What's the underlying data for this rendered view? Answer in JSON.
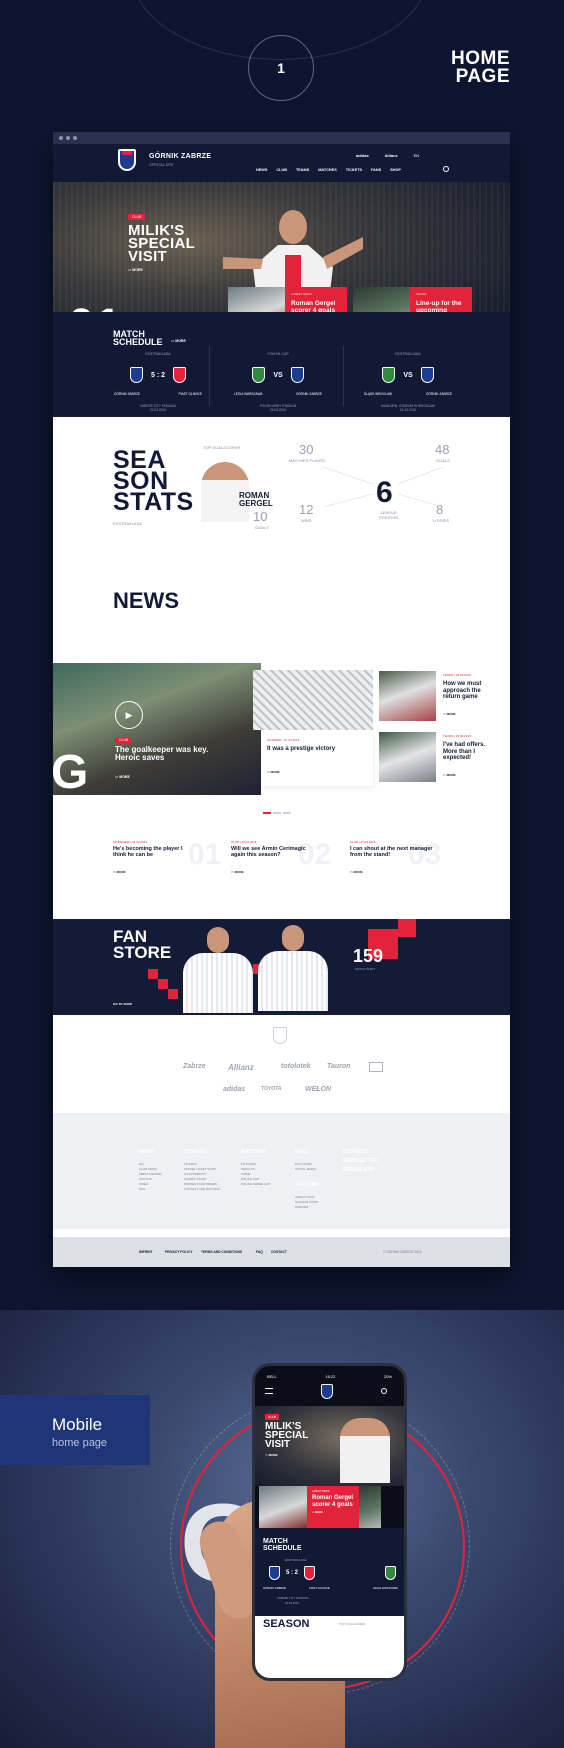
{
  "header": {
    "page_number": "1",
    "title_line1": "HOME",
    "title_line2": "PAGE"
  },
  "site": {
    "brand": "GÓRNIK ZABRZE",
    "brand_sub": "OFFICIAL SITE",
    "nav": [
      "NEWS",
      "CLUB",
      "TEAMS",
      "MATCHES",
      "TICKETS",
      "FANS",
      "SHOP"
    ],
    "nav_right": {
      "sponsor1": "adidas",
      "sponsor2": "Allianz",
      "lang": "EN"
    }
  },
  "hero": {
    "tag": "CLUB",
    "title_l1": "MILIK'S",
    "title_l2": "SPECIAL",
    "title_l3": "VISIT",
    "more": "MORE",
    "big_number": "01",
    "card1": {
      "kicker": "LATEST NEWS",
      "title": "Roman Gergel scorer 4 goals",
      "more": "MORE"
    },
    "card2": {
      "kicker": "TEAMS",
      "title": "Line-up for the upcoming match",
      "more": "MORE"
    }
  },
  "schedule": {
    "title_l1": "MATCH",
    "title_l2": "SCHEDULE",
    "more": "MORE",
    "matches": [
      {
        "competition": "EKSTRAKLASA",
        "home": "GÓRNIK ZABRZE",
        "away": "PIAST GLIWICE",
        "score": "5 : 2",
        "venue": "ZABRZE CITY STADIUM",
        "date": "20.03.2016"
      },
      {
        "competition": "POLISH CUP",
        "home": "LEGIA WARSZAWA",
        "away": "GÓRNIK ZABRZE",
        "score": "VS",
        "venue": "POLISH ARMY STADIUM",
        "date": "26.03.2016"
      },
      {
        "competition": "EKSTRAKLASA",
        "home": "ŚLĄSK WROCŁAW",
        "away": "GÓRNIK ZABRZE",
        "score": "VS",
        "venue": "MUNICIPAL STADIUM IN WROCŁAW",
        "date": "01.04.2016"
      }
    ]
  },
  "stats": {
    "title_l1": "SEA",
    "title_l2": "SON",
    "title_l3": "STATS",
    "league": "EKSTRAKLASA",
    "top_scorer_label": "TOP GOALSCORER",
    "scorer_first": "ROMAN",
    "scorer_last": "GERGEL",
    "scorer_goals": "10",
    "scorer_goals_label": "GOALS",
    "matches_played": "30",
    "matches_played_label": "MATCHES PLAYED",
    "goals": "48",
    "goals_label": "GOALS",
    "position": "6",
    "position_label_l1": "LEAGUE",
    "position_label_l2": "POSITION",
    "wins": "12",
    "wins_label": "WINS",
    "losses": "8",
    "losses_label": "LOSSES"
  },
  "news": {
    "title": "NEWS",
    "feature": {
      "tag": "CLUB",
      "title": "The goalkeeper was key. Heroic saves",
      "more": "MORE"
    },
    "card_prestige": {
      "kicker": "ACADEMY | 27.03.2016",
      "title": "It was a prestige victory",
      "more": "MORE"
    },
    "card_approach": {
      "kicker": "TEAMS | 26.03.2016",
      "title": "How we must approach the return game",
      "more": "MORE"
    },
    "card_offers": {
      "kicker": "TEAMS | 25.03.2016",
      "title": "I've had offers. More than I expected!",
      "more": "MORE"
    },
    "row": [
      {
        "kicker": "INTERVIEW | 24.03.2016",
        "title": "He's becoming the player I think he can be",
        "more": "MORE",
        "ghost": "01"
      },
      {
        "kicker": "CLUB | 22.03.2016",
        "title": "Will we see Armin Cerimagic again this season?",
        "more": "MORE",
        "ghost": "02"
      },
      {
        "kicker": "CLUB | 20.03.2016",
        "title": "I can shout at the next manager from the stand!",
        "more": "MORE",
        "ghost": "03"
      }
    ]
  },
  "fanstore": {
    "title_l1": "FAN",
    "title_l2": "STORE",
    "count": "159",
    "count_label": "MATCH SHIRT",
    "cta": "GO TO SHOP"
  },
  "sponsors": [
    "Zabrze",
    "Allianz",
    "totolotek",
    "Tauron",
    "adidas",
    "TOYOTA",
    "WEŁON"
  ],
  "footer": {
    "columns": [
      {
        "heading": "NEWS",
        "items": [
          "ALL",
          "CLUB NEWS",
          "MEDIA CENTER",
          "PHOTOS",
          "VIDEO",
          "RSS"
        ]
      },
      {
        "heading": "TICKETS",
        "items": [
          "TICKETS",
          "ONLINE TICKET SHOP",
          "ACCESSIBILITY",
          "COMBO TICKET",
          "PAYMENT AND PRICES",
          "CONTACT AND BOOKING"
        ]
      },
      {
        "heading": "MATCHES",
        "items": [
          "FIXTURES",
          "RESULTS",
          "TABLE",
          "POLISH CUP",
          "POLISH SUPER CUP"
        ]
      },
      {
        "heading": "FANS",
        "items": [
          "FAN CLUBS",
          "SOCIAL MEDIA"
        ]
      }
    ],
    "stadium": {
      "heading": "STADIUM",
      "items": [
        "ARENA TOUR",
        "STADIUM FOOD",
        "PARKING"
      ]
    },
    "extras": [
      "BUSINESS",
      "NEWSLETTER",
      "MOBILE APP"
    ],
    "legal": [
      "IMPRINT",
      "PRIVACY POLICY",
      "TERMS AND CONDITIONS",
      "FAQ",
      "CONTACT"
    ],
    "copyright": "© GÓRNIK ZABRZE 2016"
  },
  "mobile": {
    "label": "Mobile",
    "sublabel": "home page",
    "status_carrier": "BELL",
    "status_time": "16:22",
    "status_battery": "20%",
    "hero_tag": "CLUB",
    "hero_l1": "MILIK'S",
    "hero_l2": "SPECIAL",
    "hero_l3": "VISIT",
    "hero_more": "MORE",
    "card1": {
      "kicker": "LATEST NEWS",
      "title": "Roman Gergel scorer 4 goals",
      "more": "MORE"
    },
    "card2": {
      "kicker": "TEAMS",
      "title": "Line-up for the upcoming match",
      "more": "MORE"
    },
    "sched_l1": "MATCH",
    "sched_l2": "SCHEDULE",
    "league": "EKSTRAKLASA",
    "home": "GÓRNIK ZABRZE",
    "away": "PIAST GLIWICE",
    "third_team": "LEGIA WARSZAWA",
    "score": "5 : 2",
    "venue": "ZABRZE CITY STADIUM",
    "date": "20.03.2016",
    "season_peek": "SEASON",
    "top_scorer": "TOP GOALSCORER"
  },
  "colors": {
    "navy": "#111935",
    "accent_red": "#e4233a",
    "page_bg": "#0e1530"
  }
}
